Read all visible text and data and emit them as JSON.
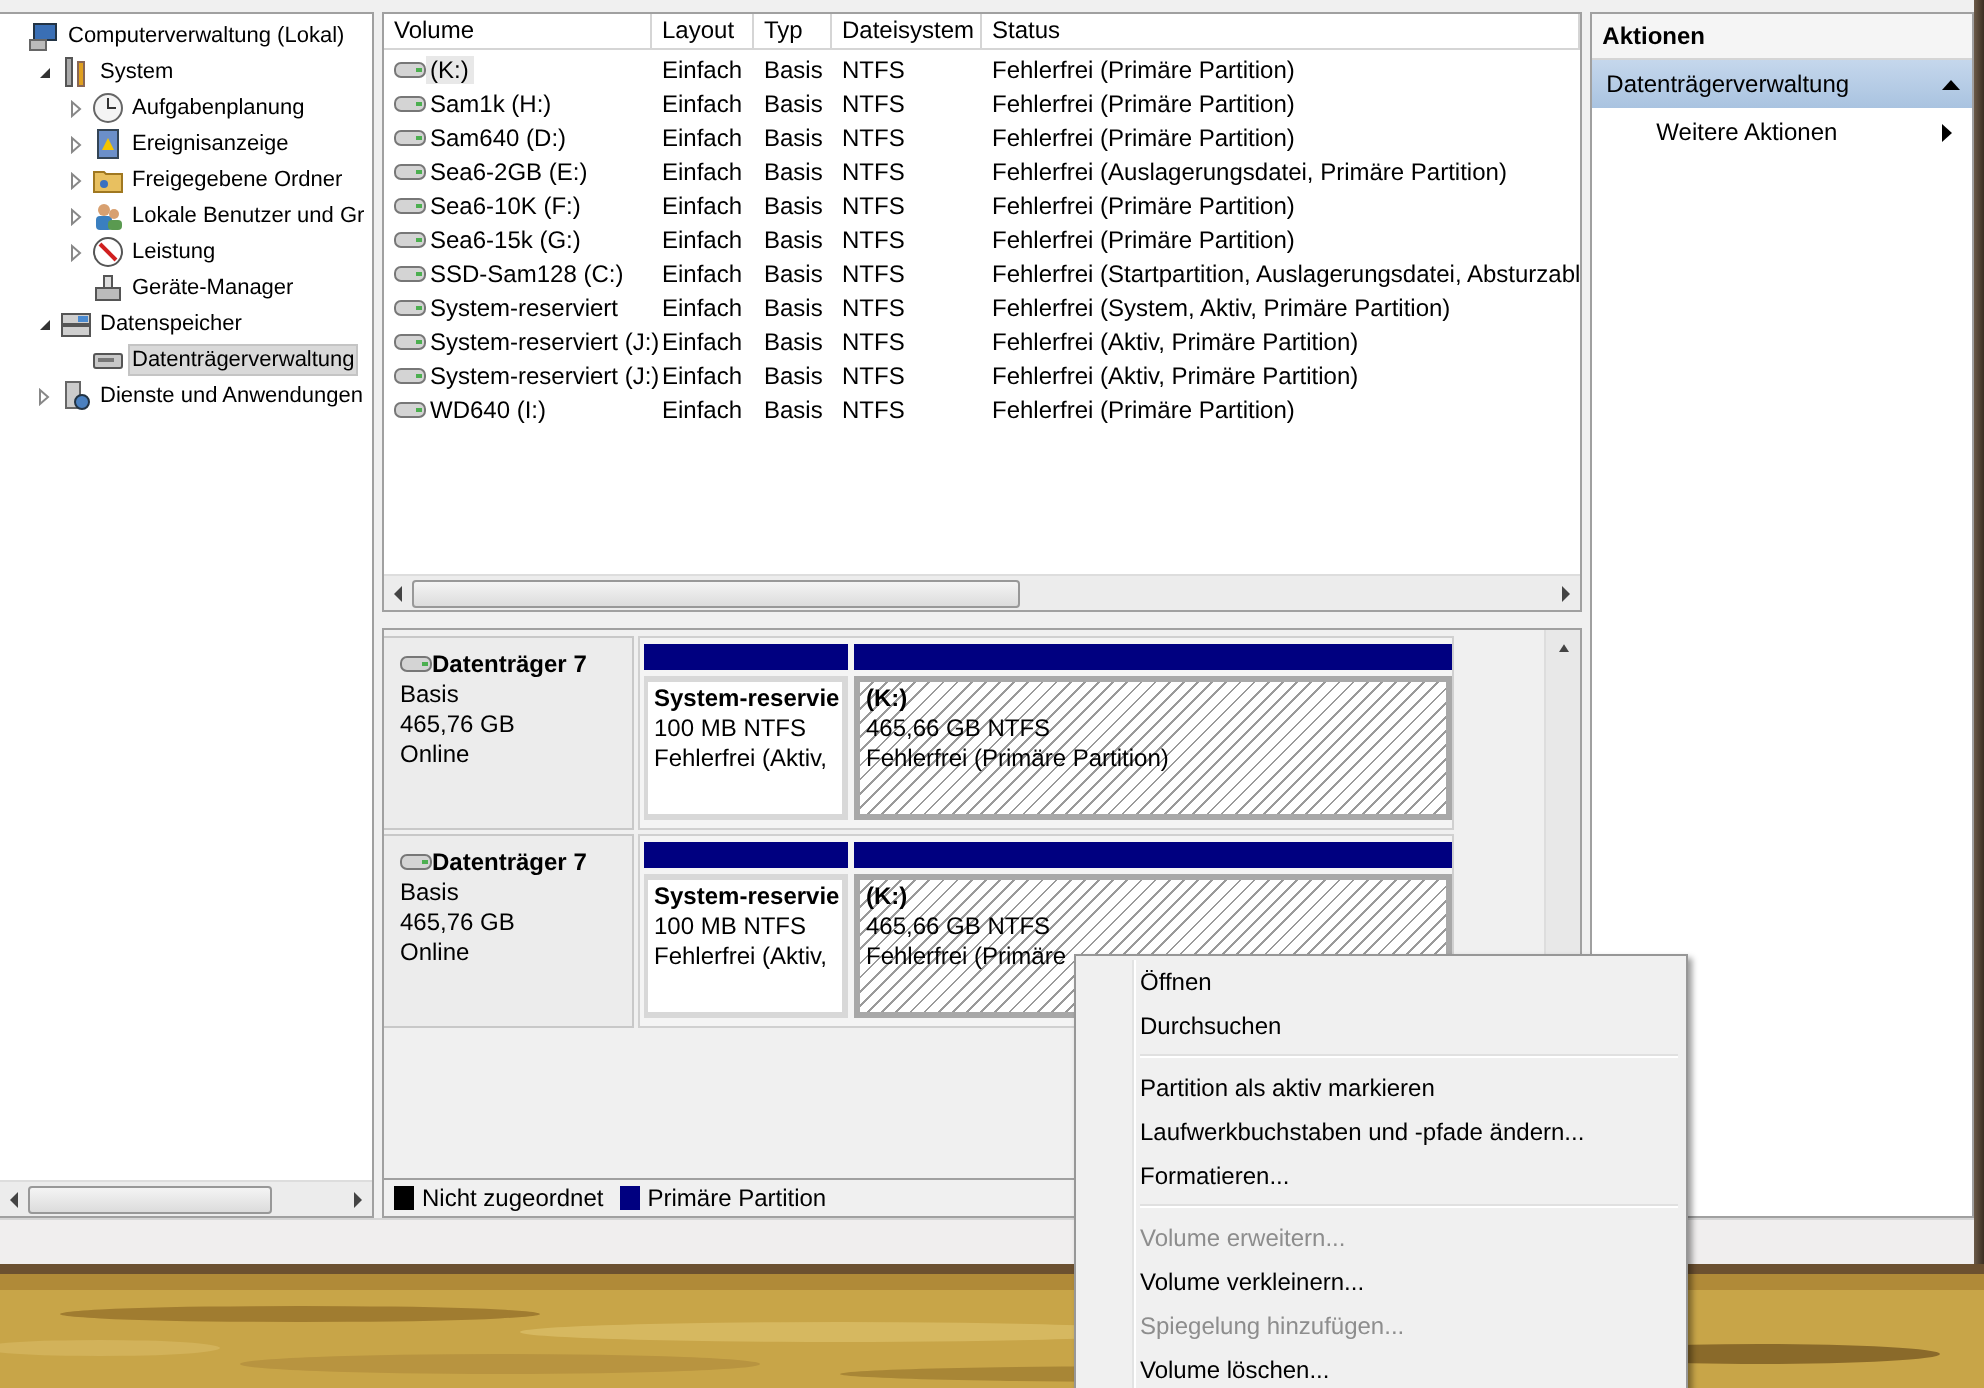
{
  "tree": [
    {
      "label": "Computerverwaltung (Lokal)",
      "selected": false,
      "children": [
        {
          "label": "System",
          "expanded": true,
          "selected": false,
          "children": [
            {
              "label": "Aufgabenplanung",
              "expanded": false,
              "selected": false
            },
            {
              "label": "Ereignisanzeige",
              "expanded": false,
              "selected": false
            },
            {
              "label": "Freigegebene Ordner",
              "expanded": false,
              "selected": false
            },
            {
              "label": "Lokale Benutzer und Gr",
              "expanded": false,
              "selected": false
            },
            {
              "label": "Leistung",
              "expanded": false,
              "selected": false
            },
            {
              "label": "Geräte-Manager",
              "selected": false
            }
          ]
        },
        {
          "label": "Datenspeicher",
          "expanded": true,
          "selected": false,
          "children": [
            {
              "label": "Datenträgerverwaltung",
              "selected": true
            }
          ]
        },
        {
          "label": "Dienste und Anwendungen",
          "expanded": false,
          "selected": false
        }
      ]
    }
  ],
  "table": {
    "columns": [
      "Volume",
      "Layout",
      "Typ",
      "Dateisystem",
      "Status"
    ],
    "rows": [
      {
        "selected": true,
        "cells": [
          "(K:)",
          "Einfach",
          "Basis",
          "NTFS",
          "Fehlerfrei (Primäre Partition)"
        ]
      },
      {
        "selected": false,
        "cells": [
          "Sam1k (H:)",
          "Einfach",
          "Basis",
          "NTFS",
          "Fehlerfrei (Primäre Partition)"
        ]
      },
      {
        "selected": false,
        "cells": [
          "Sam640 (D:)",
          "Einfach",
          "Basis",
          "NTFS",
          "Fehlerfrei (Primäre Partition)"
        ]
      },
      {
        "selected": false,
        "cells": [
          "Sea6-2GB (E:)",
          "Einfach",
          "Basis",
          "NTFS",
          "Fehlerfrei (Auslagerungsdatei, Primäre Partition)"
        ]
      },
      {
        "selected": false,
        "cells": [
          "Sea6-10K (F:)",
          "Einfach",
          "Basis",
          "NTFS",
          "Fehlerfrei (Primäre Partition)"
        ]
      },
      {
        "selected": false,
        "cells": [
          "Sea6-15k (G:)",
          "Einfach",
          "Basis",
          "NTFS",
          "Fehlerfrei (Primäre Partition)"
        ]
      },
      {
        "selected": false,
        "cells": [
          "SSD-Sam128 (C:)",
          "Einfach",
          "Basis",
          "NTFS",
          "Fehlerfrei (Startpartition, Auslagerungsdatei, Absturzabl"
        ]
      },
      {
        "selected": false,
        "cells": [
          "System-reserviert",
          "Einfach",
          "Basis",
          "NTFS",
          "Fehlerfrei (System, Aktiv, Primäre Partition)"
        ]
      },
      {
        "selected": false,
        "cells": [
          "System-reserviert (J:)",
          "Einfach",
          "Basis",
          "NTFS",
          "Fehlerfrei (Aktiv, Primäre Partition)"
        ]
      },
      {
        "selected": false,
        "cells": [
          "System-reserviert (J:)",
          "Einfach",
          "Basis",
          "NTFS",
          "Fehlerfrei (Aktiv, Primäre Partition)"
        ]
      },
      {
        "selected": false,
        "cells": [
          "WD640 (I:)",
          "Einfach",
          "Basis",
          "NTFS",
          "Fehlerfrei (Primäre Partition)"
        ]
      }
    ]
  },
  "disks": [
    {
      "name": "Datenträger 7",
      "type": "Basis",
      "size": "465,76 GB",
      "state": "Online",
      "partitions": [
        {
          "name": "System-reservie",
          "size": "100 MB NTFS",
          "status": "Fehlerfrei (Aktiv,",
          "selected": false
        },
        {
          "name": "(K:)",
          "size": "465,66 GB NTFS",
          "status": "Fehlerfrei (Primäre Partition)",
          "selected": true
        }
      ]
    },
    {
      "name": "Datenträger 7",
      "type": "Basis",
      "size": "465,76 GB",
      "state": "Online",
      "partitions": [
        {
          "name": "System-reservie",
          "size": "100 MB NTFS",
          "status": "Fehlerfrei (Aktiv,",
          "selected": false
        },
        {
          "name": "(K:)",
          "size": "465,66 GB NTFS",
          "status": "Fehlerfrei (Primäre",
          "selected": true
        }
      ]
    }
  ],
  "legend": [
    {
      "label": "Nicht zugeordnet",
      "color": "#000000"
    },
    {
      "label": "Primäre Partition",
      "color": "#000080"
    }
  ],
  "actions": {
    "title": "Aktionen",
    "section": "Datenträgerverwaltung",
    "items": [
      "Weitere Aktionen"
    ]
  },
  "context_menu": [
    {
      "kind": "item",
      "label": "Öffnen",
      "disabled": false
    },
    {
      "kind": "item",
      "label": "Durchsuchen",
      "disabled": false
    },
    {
      "kind": "separator"
    },
    {
      "kind": "item",
      "label": "Partition als aktiv markieren",
      "disabled": false
    },
    {
      "kind": "item",
      "label": "Laufwerkbuchstaben und -pfade ändern...",
      "disabled": false
    },
    {
      "kind": "item",
      "label": "Formatieren...",
      "disabled": false
    },
    {
      "kind": "separator"
    },
    {
      "kind": "item",
      "label": "Volume erweitern...",
      "disabled": true
    },
    {
      "kind": "item",
      "label": "Volume verkleinern...",
      "disabled": false
    },
    {
      "kind": "item",
      "label": "Spiegelung hinzufügen...",
      "disabled": true
    },
    {
      "kind": "item",
      "label": "Volume löschen...",
      "disabled": false
    }
  ]
}
